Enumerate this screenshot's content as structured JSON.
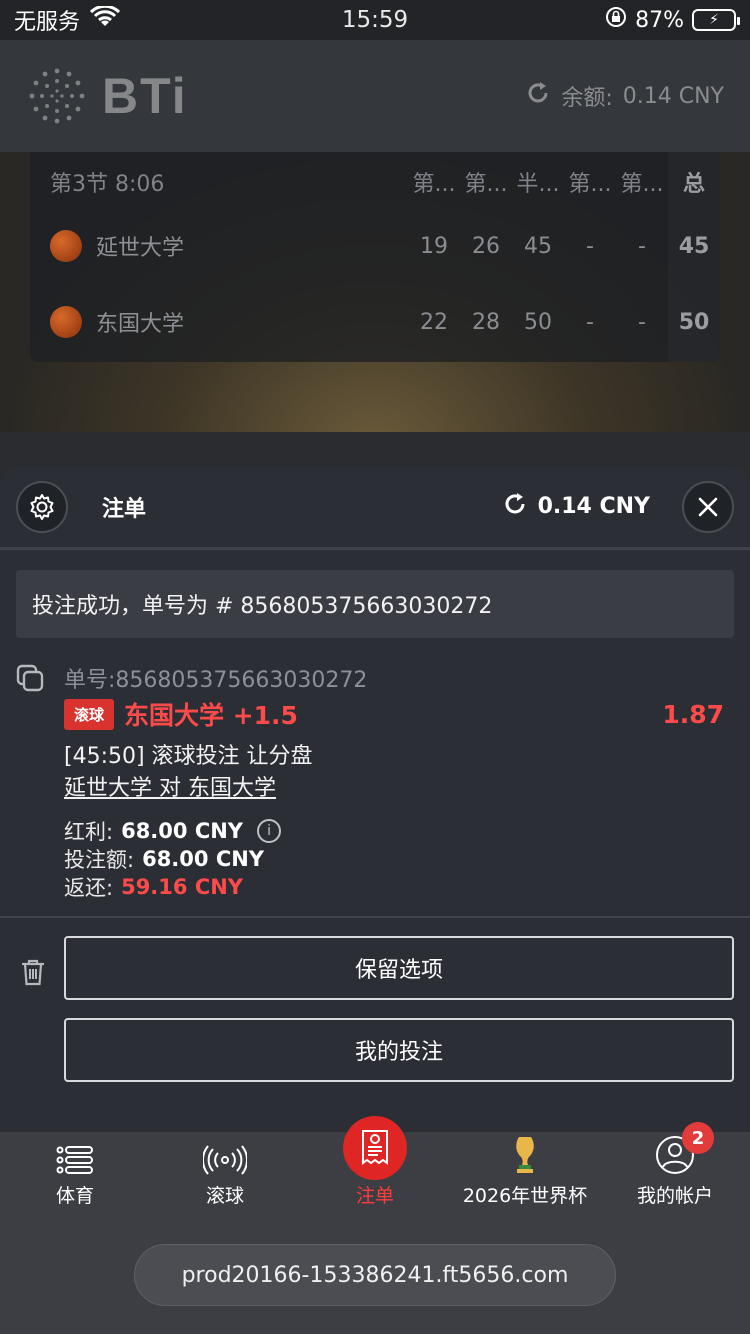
{
  "status_bar": {
    "carrier": "无服务",
    "time": "15:59",
    "battery": "87%"
  },
  "header": {
    "logo": "BTi",
    "balance_label": "余额:",
    "balance_value": "0.14 CNY"
  },
  "scoreboard": {
    "period": "第3节 8:06",
    "columns": [
      "第...",
      "第...",
      "半...",
      "第...",
      "第..."
    ],
    "total_label": "总",
    "teams": [
      {
        "name": "延世大学",
        "scores": [
          "19",
          "26",
          "45",
          "-",
          "-"
        ],
        "total": "45"
      },
      {
        "name": "东国大学",
        "scores": [
          "22",
          "28",
          "50",
          "-",
          "-"
        ],
        "total": "50"
      }
    ]
  },
  "slip": {
    "title": "注单",
    "balance": "0.14 CNY",
    "notice": "投注成功，单号为 # 856805375663030272",
    "bet": {
      "id_label": "单号:",
      "id_value": "856805375663030272",
      "live_tag": "滚球",
      "selection": "东国大学 +1.5",
      "odds": "1.87",
      "market": "[45:50] 滚球投注 让分盘",
      "matchup": "延世大学 对 东国大学",
      "bonus_label": "红利:",
      "bonus_value": "68.00 CNY",
      "stake_label": "投注额:",
      "stake_value": "68.00 CNY",
      "return_label": "返还:",
      "return_value": "59.16 CNY"
    },
    "keep_button": "保留选项",
    "my_bets_button": "我的投注"
  },
  "bottom_nav": {
    "items": [
      {
        "label": "体育",
        "icon": "list-icon"
      },
      {
        "label": "滚球",
        "icon": "live-broadcast-icon"
      },
      {
        "label": "注单",
        "icon": "receipt-icon"
      },
      {
        "label": "2026年世界杯",
        "icon": "trophy-icon"
      },
      {
        "label": "我的帐户",
        "icon": "user-icon"
      }
    ],
    "account_badge": "2"
  },
  "url": "prod20166-153386241.ft5656.com",
  "colors": {
    "accent_red": "#ff4a4a",
    "live_tag_red": "#d8332f",
    "panel_bg": "#2b2f35"
  }
}
